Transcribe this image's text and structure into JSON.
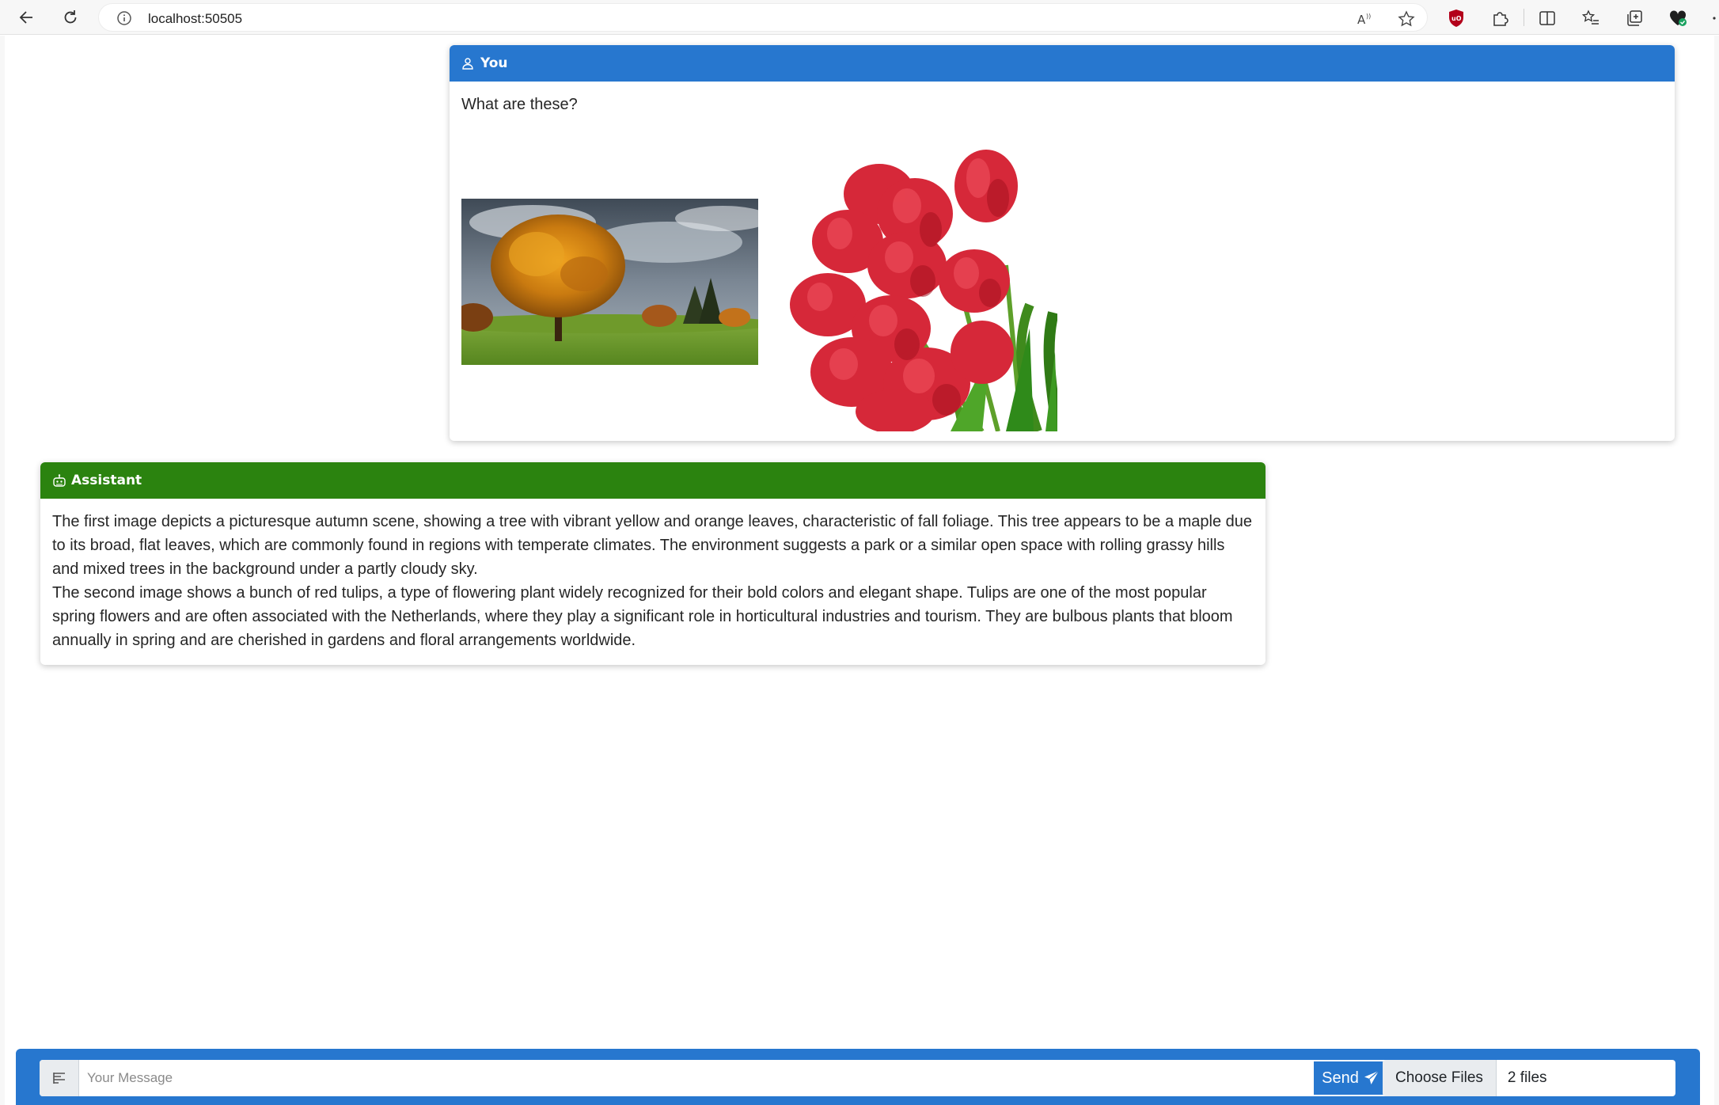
{
  "browser": {
    "url": "localhost:50505"
  },
  "user_message": {
    "header": "You",
    "text": "What are these?",
    "images": [
      "tree-image",
      "tulips-image"
    ]
  },
  "assistant_message": {
    "header": "Assistant",
    "paragraphs": [
      "The first image depicts a picturesque autumn scene, showing a tree with vibrant yellow and orange leaves, characteristic of fall foliage. This tree appears to be a maple due to its broad, flat leaves, which are commonly found in regions with temperate climates. The environment suggests a park or a similar open space with rolling grassy hills and mixed trees in the background under a partly cloudy sky.",
      "The second image shows a bunch of red tulips, a type of flowering plant widely recognized for their bold colors and elegant shape. Tulips are one of the most popular spring flowers and are often associated with the Netherlands, where they play a significant role in horticultural industries and tourism. They are bulbous plants that bloom annually in spring and are cherished in gardens and floral arrangements worldwide."
    ]
  },
  "composer": {
    "placeholder": "Your Message",
    "send_label": "Send",
    "choose_files_label": "Choose Files",
    "file_count": "2 files"
  },
  "colors": {
    "user_header": "#2777cf",
    "assistant_header": "#2b830f",
    "input_bar": "#2777cf"
  }
}
